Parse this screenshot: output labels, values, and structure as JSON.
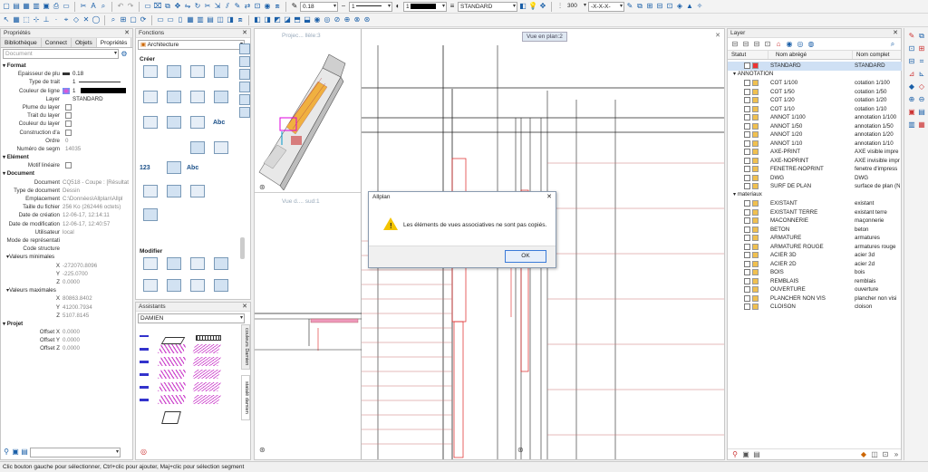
{
  "toolbar1": {
    "line_thickness": "0.18",
    "line_type": "1",
    "line_color": "1",
    "layer": "STANDARD",
    "scale": "300",
    "hatch_pattern": "-X-X-X-"
  },
  "props_panel": {
    "title": "Propriétés",
    "tabs": [
      "Bibliothèque",
      "Connect",
      "Objets",
      "Propriétés"
    ],
    "filter_placeholder": "Document",
    "sections": {
      "format": "Format",
      "element": "Elément",
      "document": "Document",
      "projet": "Projet"
    },
    "format_rows": [
      {
        "label": "Epaisseur de plu",
        "value": "0.18"
      },
      {
        "label": "Type de trait",
        "value": "1"
      },
      {
        "label": "Couleur de ligne",
        "value": "1"
      },
      {
        "label": "Layer",
        "value": "STANDARD"
      },
      {
        "label": "Plume du layer",
        "value": ""
      },
      {
        "label": "Trait du layer",
        "value": ""
      },
      {
        "label": "Couleur du layer",
        "value": ""
      },
      {
        "label": "Construction d'a",
        "value": ""
      },
      {
        "label": "Ordre",
        "value": "0"
      },
      {
        "label": "Numéro de segm",
        "value": "14035"
      }
    ],
    "element_rows": [
      {
        "label": "Motif linéaire",
        "value": ""
      }
    ],
    "document_rows": [
      {
        "label": "Document",
        "value": "CQ518 - Coupe : [Résultat"
      },
      {
        "label": "Type de document",
        "value": "Dessin"
      },
      {
        "label": "Emplacement",
        "value": "C:\\Données\\Allplan\\Allpl"
      },
      {
        "label": "Taille du fichier",
        "value": "256 Ko (262446 octets)"
      },
      {
        "label": "Date de création",
        "value": "12-06-17, 12:14:11"
      },
      {
        "label": "Date de modification",
        "value": "12-06-17, 12:40:57"
      },
      {
        "label": "Utilisateur",
        "value": "local"
      },
      {
        "label": "Mode de représentati",
        "value": ""
      },
      {
        "label": "Code structure",
        "value": ""
      }
    ],
    "minvals_label": "Valeurs minimales",
    "minvals": [
      {
        "label": "X",
        "value": "-272070.8096"
      },
      {
        "label": "Y",
        "value": "-225.0700"
      },
      {
        "label": "Z",
        "value": "0.0000"
      }
    ],
    "maxvals_label": "Valeurs maximales",
    "maxvals": [
      {
        "label": "X",
        "value": "80863.8402"
      },
      {
        "label": "Y",
        "value": "41200.7934"
      },
      {
        "label": "Z",
        "value": "5107.8145"
      }
    ],
    "projet_rows": [
      {
        "label": "Offset X",
        "value": "0.0000"
      },
      {
        "label": "Offset Y",
        "value": "0.0000"
      },
      {
        "label": "Offset Z",
        "value": "0.0000"
      }
    ]
  },
  "fonctions": {
    "title": "Fonctions",
    "family": "Architecture",
    "creer": "Créer",
    "modifier": "Modifier",
    "abc": "Abc",
    "num": "123"
  },
  "assistants": {
    "title": "Assistants",
    "selected": "DAMIEN",
    "side_tab1": "couleurs Damien",
    "side_tab2": "statalé damien"
  },
  "viewports": {
    "v1": "Projec... llèle:3",
    "v2": "Vue en plan:2",
    "v3": "Vue d.... sud:1"
  },
  "dialog": {
    "title": "Allplan",
    "message": "Les éléments de vues associatives ne sont pas copiés.",
    "ok": "OK"
  },
  "layer_panel": {
    "title": "Layer",
    "headers": {
      "statut": "Statut",
      "abrege": "Nom abrégé",
      "complet": "Nom complet"
    },
    "standard": {
      "short": "STANDARD",
      "full": "STANDARD"
    },
    "groups": [
      {
        "name": "ANNOTATION",
        "items": [
          {
            "short": "COT 1/100",
            "full": "cotation 1/100"
          },
          {
            "short": "COT 1/50",
            "full": "cotation 1/50"
          },
          {
            "short": "COT 1/20",
            "full": "cotation 1/20"
          },
          {
            "short": "COT 1/10",
            "full": "cotation 1/10"
          },
          {
            "short": "ANNOT 1/100",
            "full": "annotation 1/100"
          },
          {
            "short": "ANNOT 1/50",
            "full": "annotation 1/50"
          },
          {
            "short": "ANNOT 1/20",
            "full": "annotation 1/20"
          },
          {
            "short": "ANNOT 1/10",
            "full": "annotation 1/10"
          },
          {
            "short": "AXE-PRINT",
            "full": "AXE visible impre"
          },
          {
            "short": "AXE-NOPRINT",
            "full": "AXE invisible impr"
          },
          {
            "short": "FENETRE-NOPRINT",
            "full": "fenetre d'impress"
          },
          {
            "short": "DWG",
            "full": "DWG"
          },
          {
            "short": "SURF DE PLAN",
            "full": "surface de plan (N"
          }
        ]
      },
      {
        "name": "materiaux",
        "items": [
          {
            "short": "EXISTANT",
            "full": "existant"
          },
          {
            "short": "EXISTANT TERRE",
            "full": "existant terre"
          },
          {
            "short": "MACONNERIE",
            "full": "maçonnerie"
          },
          {
            "short": "BETON",
            "full": "beton"
          },
          {
            "short": "ARMATURE",
            "full": "armatures"
          },
          {
            "short": "ARMATURE ROUGE",
            "full": "armatures rouge"
          },
          {
            "short": "ACIER 3D",
            "full": "acier 3d"
          },
          {
            "short": "ACIER 2D",
            "full": "acier 2d"
          },
          {
            "short": "BOIS",
            "full": "bois"
          },
          {
            "short": "REMBLAIS",
            "full": "remblais"
          },
          {
            "short": "OUVERTURE",
            "full": "ouverture"
          },
          {
            "short": "PLANCHER NON VIS",
            "full": "plancher non visi"
          },
          {
            "short": "CLOISON",
            "full": "cloison"
          }
        ]
      }
    ]
  },
  "status_bar": "Clic bouton gauche pour sélectionner, Ctrl+clic pour ajouter, Maj+clic pour sélection segment"
}
